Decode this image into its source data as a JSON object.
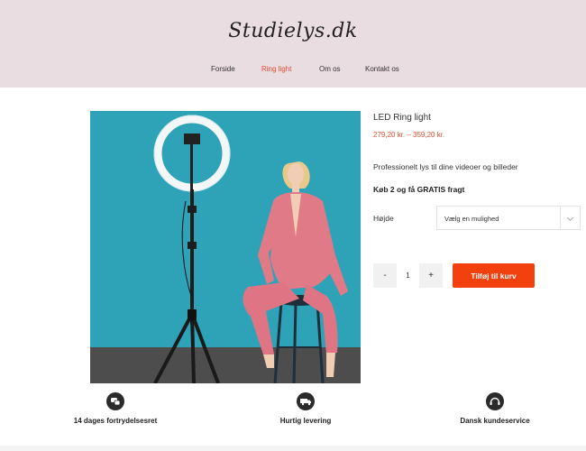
{
  "header": {
    "logo": "Studielys.dk",
    "nav": [
      {
        "label": "Forside",
        "active": false
      },
      {
        "label": "Ring light",
        "active": true
      },
      {
        "label": "Om os",
        "active": false
      },
      {
        "label": "Kontakt os",
        "active": false
      }
    ]
  },
  "product": {
    "title": "LED Ring light",
    "price": "279,20 kr. – 359,20 kr.",
    "description": "Professionelt lys til dine videoer og billeder",
    "promo": "Køb 2 og få GRATIS fragt",
    "variation": {
      "label": "Højde",
      "selected": "Vælg en mulighed"
    },
    "quantity": {
      "minus": "-",
      "value": "1",
      "plus": "+"
    },
    "add_to_cart": "Tilføj til kurv"
  },
  "features": [
    {
      "label": "14 dages fortrydelsesret",
      "icon": "chat-bubbles-icon"
    },
    {
      "label": "Hurtig levering",
      "icon": "truck-icon"
    },
    {
      "label": "Dansk kundeservice",
      "icon": "headset-icon"
    }
  ],
  "colors": {
    "header_bg": "#e9dde1",
    "accent": "#e24a2c",
    "button": "#f2410f",
    "image_bg": "#2ea3b8"
  }
}
